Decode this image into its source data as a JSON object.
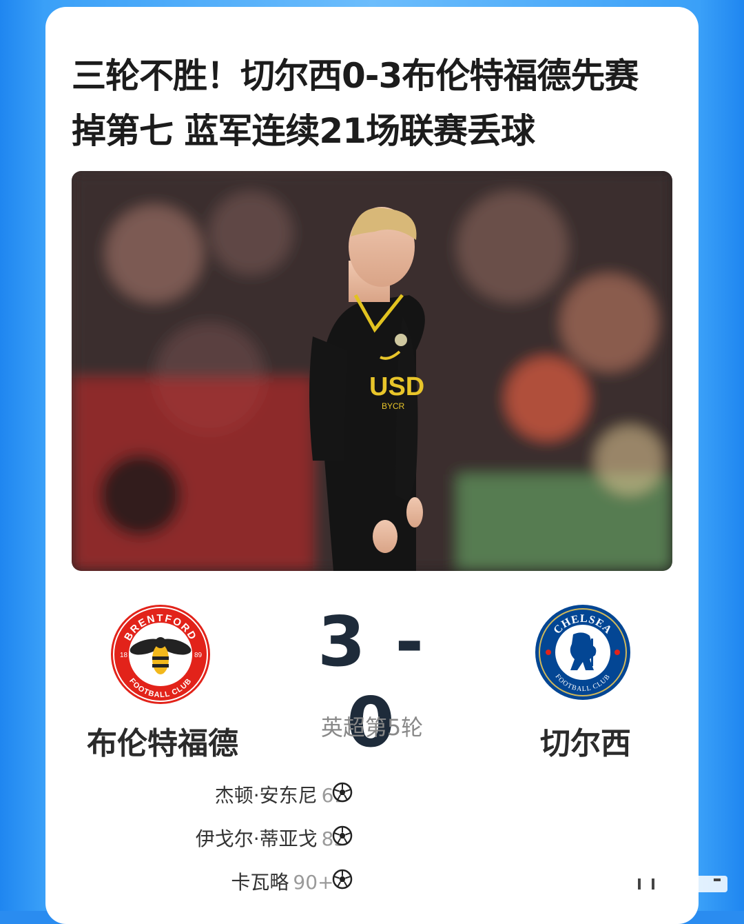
{
  "article": {
    "headline_line1": "三轮不胜！切尔西0-3布伦特福德先赛",
    "headline_line2": "掉第七 蓝军连续21场联赛丢球"
  },
  "match": {
    "home_team": "布伦特福德",
    "away_team": "切尔西",
    "score": "3 - 0",
    "round": "英超第5轮"
  },
  "home_logo": {
    "ring_text_top": "BRENTFORD",
    "ring_text_bottom": "FOOTBALL CLUB",
    "year_left": "18",
    "year_right": "89"
  },
  "away_logo": {
    "ring_text_top": "CHELSEA",
    "ring_text_bottom": "FOOTBALL CLUB"
  },
  "scorers": [
    {
      "name": "杰顿·安东尼",
      "minute": "61'"
    },
    {
      "name": "伊戈尔·蒂亚戈",
      "minute": "83'"
    },
    {
      "name": "卡瓦略",
      "minute": "90+4'"
    }
  ],
  "photo": {
    "shirt_sponsor": "USD",
    "shirt_sponsor_sub": "BYCR"
  },
  "colors": {
    "background": "#2a8cf0",
    "card": "#ffffff",
    "score": "#1e2b3a",
    "brentford_red": "#e2231a",
    "chelsea_blue": "#034694"
  }
}
